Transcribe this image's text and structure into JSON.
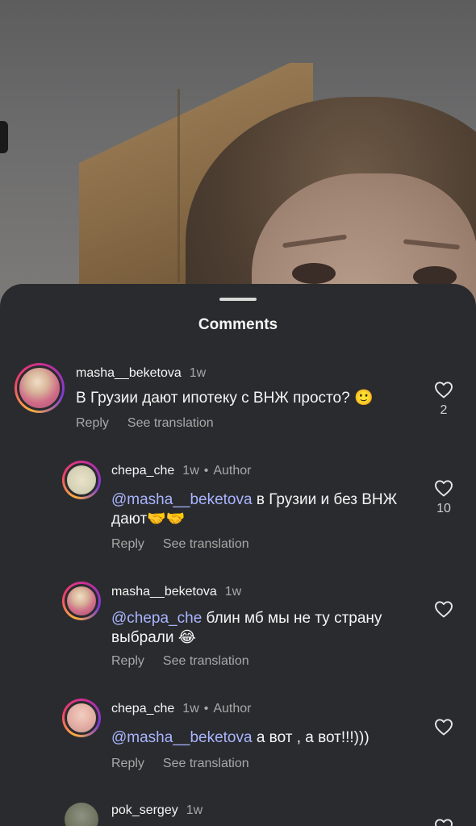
{
  "sheet": {
    "title": "Comments"
  },
  "comments": [
    {
      "username": "masha__beketova",
      "time": "1w",
      "author": "",
      "mention": "",
      "text": "В Грузии дают ипотеку с ВНЖ просто? 🙂",
      "reply": "Reply",
      "translate": "See translation",
      "likes": "2"
    },
    {
      "username": "chepa_che",
      "time": "1w",
      "dot": "•",
      "author": "Author",
      "mention": "@masha__beketova",
      "text": " в Грузии и без ВНЖ дают🤝🤝",
      "reply": "Reply",
      "translate": "See translation",
      "likes": "10"
    },
    {
      "username": "masha__beketova",
      "time": "1w",
      "author": "",
      "mention": "@chepa_che",
      "text": " блин мб мы не ту страну выбрали 😂",
      "reply": "Reply",
      "translate": "See translation",
      "likes": ""
    },
    {
      "username": "chepa_che",
      "time": "1w",
      "dot": "•",
      "author": "Author",
      "mention": "@masha__beketova",
      "text": " а вот , а вот!!!)))",
      "reply": "Reply",
      "translate": "See translation",
      "likes": ""
    },
    {
      "username": "pok_sergey",
      "time": "1w",
      "author": "",
      "mention": "",
      "text": "",
      "reply": "",
      "translate": "",
      "likes": ""
    }
  ],
  "icons": {
    "like": "heart-outline-icon"
  },
  "colors": {
    "sheet_bg": "#2a2b2e",
    "mention": "#a9b4ff",
    "secondary_text": "#a8a8a8"
  }
}
